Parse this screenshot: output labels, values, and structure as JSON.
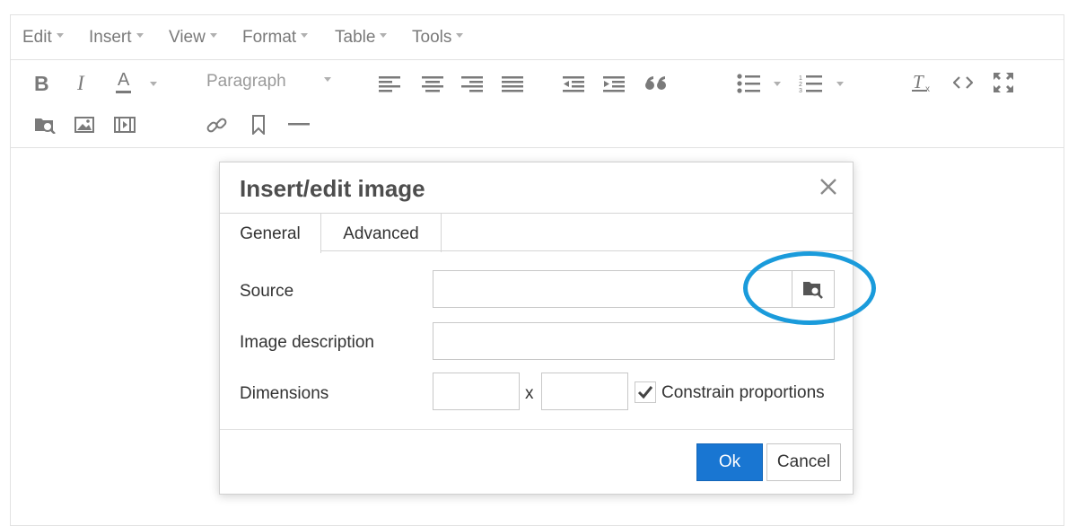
{
  "menubar": {
    "items": [
      "Edit",
      "Insert",
      "View",
      "Format",
      "Table",
      "Tools"
    ]
  },
  "toolbar": {
    "bold_label": "B",
    "italic_label": "I",
    "text_color_label": "A",
    "block_format": "Paragraph",
    "icons": [
      "bold-icon",
      "italic-icon",
      "text-color-icon",
      "align-left-icon",
      "align-center-icon",
      "align-right-icon",
      "align-justify-icon",
      "outdent-icon",
      "indent-icon",
      "blockquote-icon",
      "bullet-list-icon",
      "numbered-list-icon",
      "clear-formatting-icon",
      "source-code-icon",
      "fullscreen-icon",
      "file-browser-icon",
      "image-icon",
      "media-icon",
      "link-icon",
      "bookmark-icon",
      "horizontal-rule-icon"
    ]
  },
  "dialog": {
    "title": "Insert/edit image",
    "tabs": [
      "General",
      "Advanced"
    ],
    "source_label": "Source",
    "source_value": "",
    "description_label": "Image description",
    "description_value": "",
    "dimensions_label": "Dimensions",
    "width_value": "",
    "height_value": "",
    "dimensions_separator": "x",
    "constrain_label": "Constrain proportions",
    "constrain_checked": true,
    "ok_label": "Ok",
    "cancel_label": "Cancel"
  },
  "colors": {
    "accent": "#1976d2",
    "highlight": "#1a9bdb"
  }
}
